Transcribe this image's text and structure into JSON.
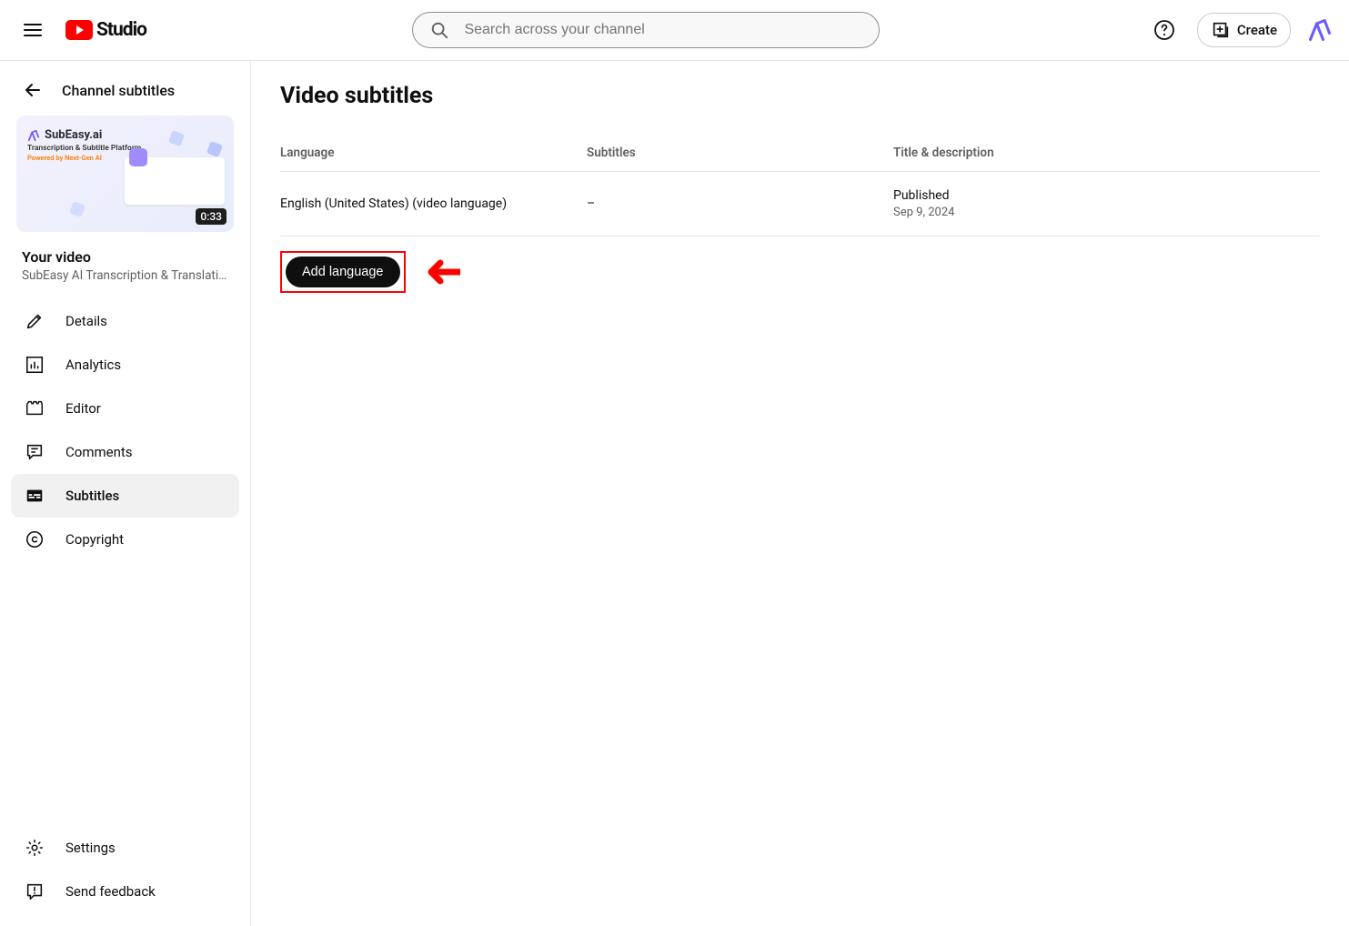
{
  "header": {
    "logo_text": "Studio",
    "search_placeholder": "Search across your channel",
    "create_label": "Create"
  },
  "sidebar": {
    "back_label": "Channel subtitles",
    "thumbnail": {
      "brand": "SubEasy.ai",
      "subtitle": "Transcription & Subtitle Platform",
      "powered": "Powered by",
      "powered_highlight": "Next-Gen AI",
      "duration": "0:33"
    },
    "your_video_title": "Your video",
    "your_video_name": "SubEasy AI Transcription & Translati…",
    "nav": [
      {
        "label": "Details",
        "icon": "pencil"
      },
      {
        "label": "Analytics",
        "icon": "analytics"
      },
      {
        "label": "Editor",
        "icon": "editor"
      },
      {
        "label": "Comments",
        "icon": "comments"
      },
      {
        "label": "Subtitles",
        "icon": "subtitles"
      },
      {
        "label": "Copyright",
        "icon": "copyright"
      }
    ],
    "footer": [
      {
        "label": "Settings",
        "icon": "settings"
      },
      {
        "label": "Send feedback",
        "icon": "feedback"
      }
    ]
  },
  "main": {
    "title": "Video subtitles",
    "columns": {
      "language": "Language",
      "subtitles": "Subtitles",
      "title_desc": "Title & description"
    },
    "rows": [
      {
        "language": "English (United States) (video language)",
        "subtitles": "–",
        "status": "Published",
        "date": "Sep 9, 2024"
      }
    ],
    "add_language_label": "Add language"
  }
}
